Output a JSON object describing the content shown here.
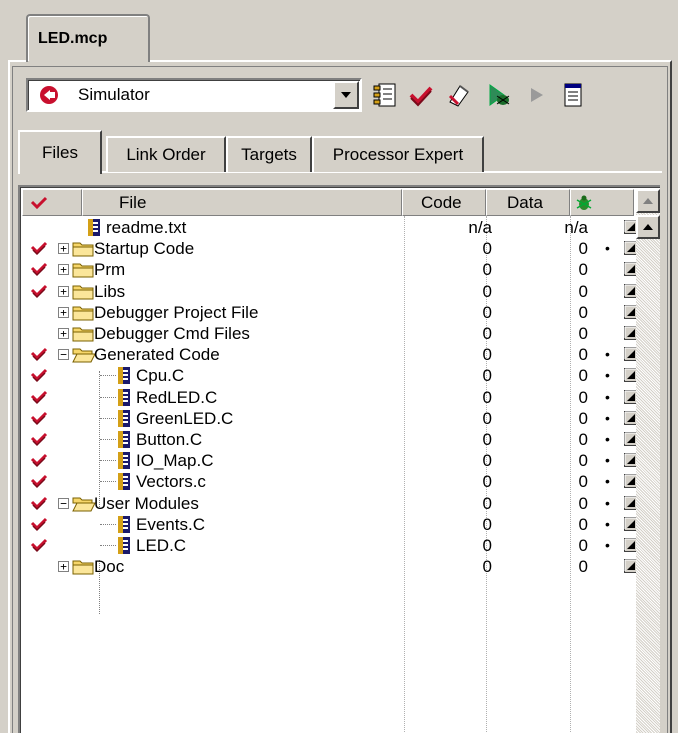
{
  "document_tab": "LED.mcp",
  "toolbar": {
    "target": "Simulator"
  },
  "tabs": [
    {
      "label": "Files",
      "active": true
    },
    {
      "label": "Link Order",
      "active": false
    },
    {
      "label": "Targets",
      "active": false
    },
    {
      "label": "Processor Expert",
      "active": false
    }
  ],
  "columns": {
    "file": "File",
    "code": "Code",
    "data": "Data"
  },
  "rows": [
    {
      "name": "readme.txt",
      "type": "file",
      "checked": false,
      "expander": "",
      "level": 0,
      "code": "n/a",
      "data": "n/a",
      "dot": ""
    },
    {
      "name": "Startup Code",
      "type": "folder",
      "checked": true,
      "expander": "+",
      "level": 0,
      "code": "0",
      "data": "0",
      "dot": "•"
    },
    {
      "name": "Prm",
      "type": "folder",
      "checked": true,
      "expander": "+",
      "level": 0,
      "code": "0",
      "data": "0",
      "dot": ""
    },
    {
      "name": "Libs",
      "type": "folder",
      "checked": true,
      "expander": "+",
      "level": 0,
      "code": "0",
      "data": "0",
      "dot": ""
    },
    {
      "name": "Debugger Project File",
      "type": "folder",
      "checked": false,
      "expander": "+",
      "level": 0,
      "code": "0",
      "data": "0",
      "dot": ""
    },
    {
      "name": "Debugger Cmd Files",
      "type": "folder",
      "checked": false,
      "expander": "+",
      "level": 0,
      "code": "0",
      "data": "0",
      "dot": ""
    },
    {
      "name": "Generated Code",
      "type": "folder-open",
      "checked": true,
      "expander": "−",
      "level": 0,
      "code": "0",
      "data": "0",
      "dot": "•"
    },
    {
      "name": "Cpu.C",
      "type": "file",
      "checked": true,
      "expander": "",
      "level": 1,
      "code": "0",
      "data": "0",
      "dot": "•"
    },
    {
      "name": "RedLED.C",
      "type": "file",
      "checked": true,
      "expander": "",
      "level": 1,
      "code": "0",
      "data": "0",
      "dot": "•"
    },
    {
      "name": "GreenLED.C",
      "type": "file",
      "checked": true,
      "expander": "",
      "level": 1,
      "code": "0",
      "data": "0",
      "dot": "•"
    },
    {
      "name": "Button.C",
      "type": "file",
      "checked": true,
      "expander": "",
      "level": 1,
      "code": "0",
      "data": "0",
      "dot": "•"
    },
    {
      "name": "IO_Map.C",
      "type": "file",
      "checked": true,
      "expander": "",
      "level": 1,
      "code": "0",
      "data": "0",
      "dot": "•"
    },
    {
      "name": "Vectors.c",
      "type": "file",
      "checked": true,
      "expander": "",
      "level": 1,
      "code": "0",
      "data": "0",
      "dot": "•"
    },
    {
      "name": "User Modules",
      "type": "folder-open",
      "checked": true,
      "expander": "−",
      "level": 0,
      "code": "0",
      "data": "0",
      "dot": "•"
    },
    {
      "name": "Events.C",
      "type": "file",
      "checked": true,
      "expander": "",
      "level": 1,
      "code": "0",
      "data": "0",
      "dot": "•"
    },
    {
      "name": "LED.C",
      "type": "file",
      "checked": true,
      "expander": "",
      "level": 1,
      "code": "0",
      "data": "0",
      "dot": "•"
    },
    {
      "name": "Doc",
      "type": "folder",
      "checked": false,
      "expander": "+",
      "level": 0,
      "code": "0",
      "data": "0",
      "dot": ""
    }
  ],
  "icons": {
    "target": "target-icon",
    "settings": "settings-icon",
    "make": "make-icon",
    "sync": "synchronize-icon",
    "debug": "debug-icon",
    "run": "run-icon",
    "project_inspector": "project-inspector-icon"
  },
  "colors": {
    "check_red": "#c8102e",
    "folder_yellow": "#f6d66a",
    "face": "#d4d0c8"
  }
}
